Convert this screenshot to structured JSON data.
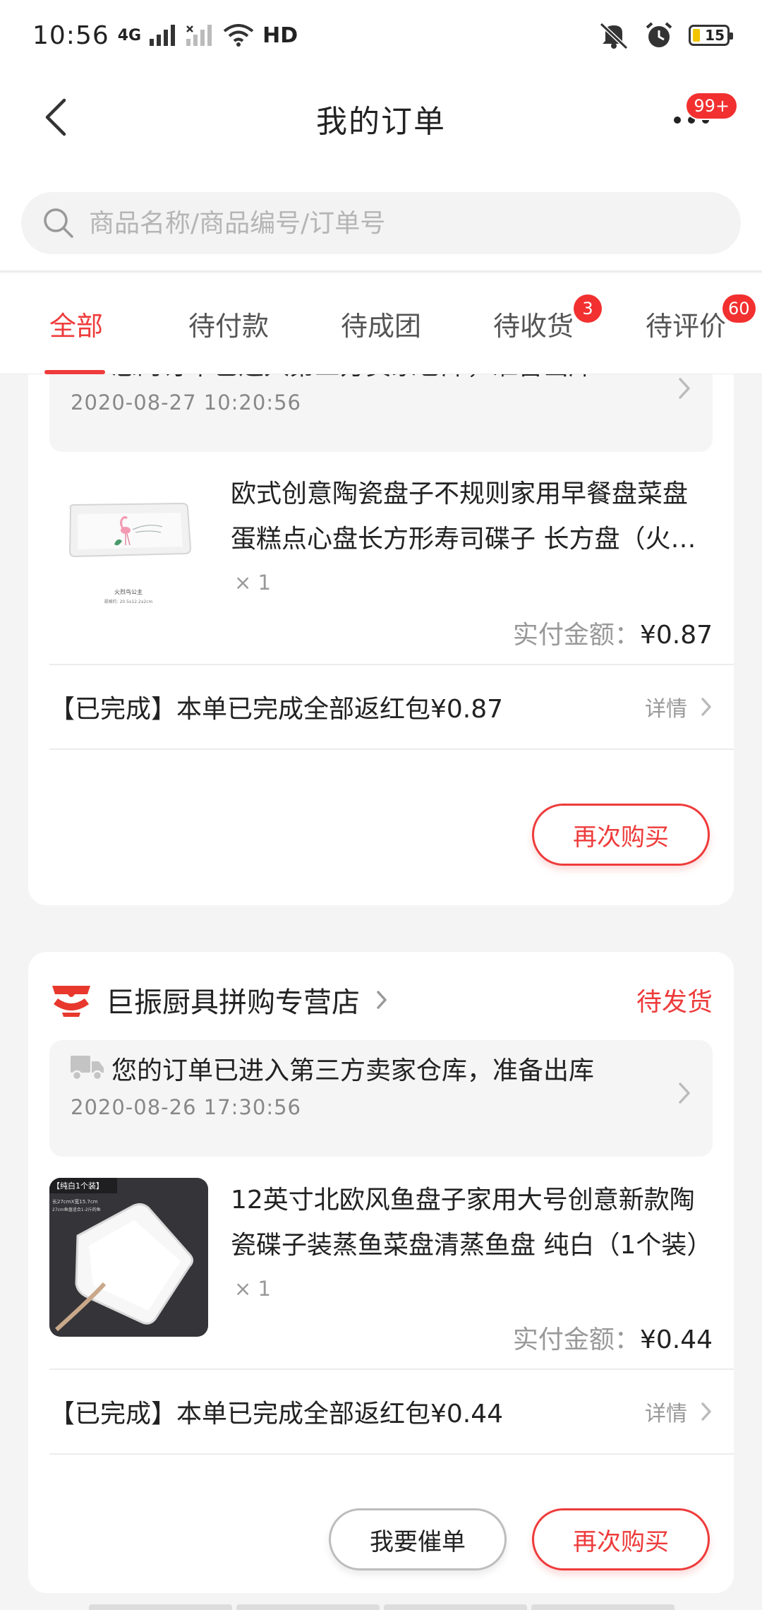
{
  "status_bar": {
    "time": "10:56",
    "network_4g": "4G",
    "network_hd": "HD",
    "battery": "15"
  },
  "nav": {
    "title": "我的订单",
    "more_badge": "99+"
  },
  "search": {
    "placeholder": "商品名称/商品编号/订单号"
  },
  "tabs": [
    {
      "label": "全部",
      "badge": ""
    },
    {
      "label": "待付款",
      "badge": ""
    },
    {
      "label": "待成团",
      "badge": ""
    },
    {
      "label": "待收货",
      "badge": "3"
    },
    {
      "label": "待评价",
      "badge": "60"
    }
  ],
  "orders": [
    {
      "shipping_text": "您的订单已进入第三方卖家仓库，准备出库",
      "shipping_time": "2020-08-27 10:20:56",
      "product_name": "欧式创意陶瓷盘子不规则家用早餐盘菜盘蛋糕点心盘长方形寿司碟子 长方盘（火烈鸟公主）",
      "image_caption": "火烈鸟公主",
      "image_subcaption": "规格约: 20.5x12.2x2cm",
      "qty": "× 1",
      "paid_label": "实付金额：",
      "paid_amount": "¥0.87",
      "status_text": "【已完成】本单已完成全部返红包¥0.87",
      "detail_label": "详情",
      "rebuy_label": "再次购买"
    },
    {
      "store_name": "巨振厨具拼购专营店",
      "store_status": "待发货",
      "shipping_text": "您的订单已进入第三方卖家仓库，准备出库",
      "shipping_time": "2020-08-26 17:30:56",
      "product_name": "12英寸北欧风鱼盘子家用大号创意新款陶瓷碟子装蒸鱼菜盘清蒸鱼盘 纯白（1个装）",
      "image_tag": "【纯白1个装】",
      "image_note": "长27cmX宽15.7cm",
      "image_note2": "27cm鱼盘适合1-2斤的鱼",
      "qty": "× 1",
      "paid_label": "实付金额：",
      "paid_amount": "¥0.44",
      "status_text": "【已完成】本单已完成全部返红包¥0.44",
      "detail_label": "详情",
      "urge_label": "我要催单",
      "rebuy_label": "再次购买"
    }
  ]
}
